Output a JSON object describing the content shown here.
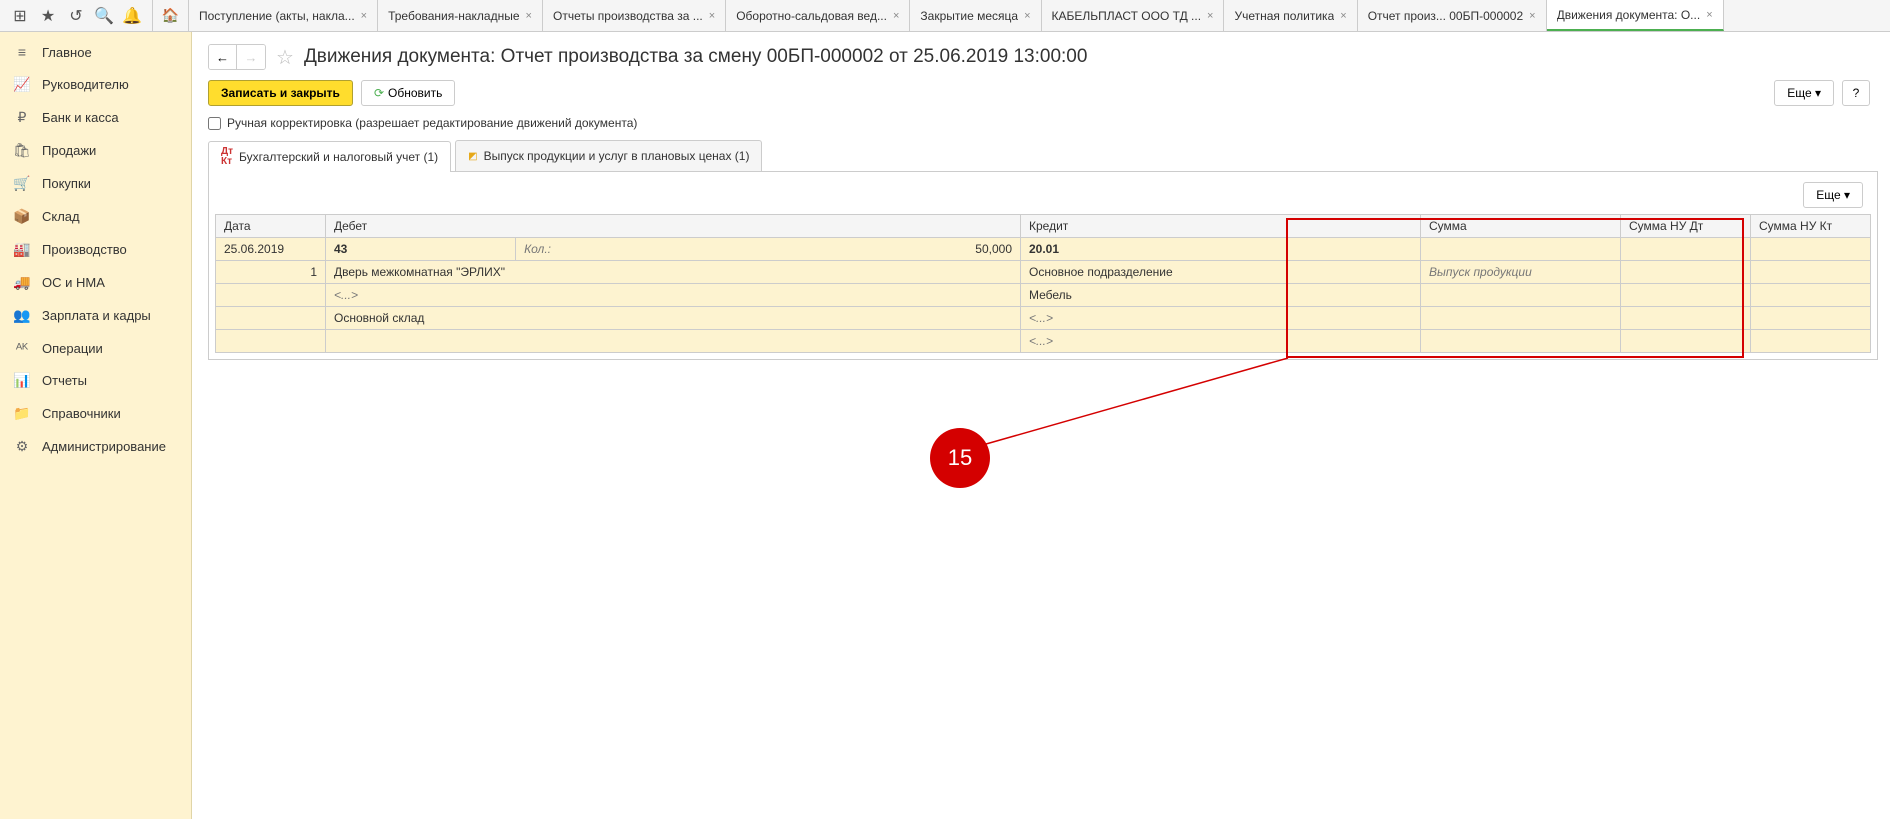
{
  "toolbar_tabs": [
    {
      "label": "Поступление (акты, накла...",
      "close": true
    },
    {
      "label": "Требования-накладные",
      "close": true
    },
    {
      "label": "Отчеты производства за ...",
      "close": true
    },
    {
      "label": "Оборотно-сальдовая вед...",
      "close": true
    },
    {
      "label": "Закрытие месяца",
      "close": true
    },
    {
      "label": "КАБЕЛЬПЛАСТ ООО ТД ...",
      "close": true
    },
    {
      "label": "Учетная политика",
      "close": true
    },
    {
      "label": "Отчет произ... 00БП-000002",
      "close": true
    },
    {
      "label": "Движения документа: О...",
      "close": true,
      "active": true
    }
  ],
  "sidebar_items": [
    {
      "icon": "≡",
      "label": "Главное"
    },
    {
      "icon": "📈",
      "label": "Руководителю"
    },
    {
      "icon": "₽",
      "label": "Банк и касса"
    },
    {
      "icon": "🛍",
      "label": "Продажи"
    },
    {
      "icon": "🛒",
      "label": "Покупки"
    },
    {
      "icon": "📦",
      "label": "Склад"
    },
    {
      "icon": "🏭",
      "label": "Производство"
    },
    {
      "icon": "🚚",
      "label": "ОС и НМА"
    },
    {
      "icon": "👥",
      "label": "Зарплата и кадры"
    },
    {
      "icon": "ᴬᴷ",
      "label": "Операции"
    },
    {
      "icon": "📊",
      "label": "Отчеты"
    },
    {
      "icon": "📁",
      "label": "Справочники"
    },
    {
      "icon": "⚙",
      "label": "Администрирование"
    }
  ],
  "page_title": "Движения документа: Отчет производства за смену 00БП-000002 от 25.06.2019 13:00:00",
  "btn_save_close": "Записать и закрыть",
  "btn_refresh": "Обновить",
  "btn_more": "Еще",
  "btn_help": "?",
  "checkbox_label": "Ручная корректировка (разрешает редактирование движений документа)",
  "subtabs": [
    {
      "label": "Бухгалтерский и налоговый учет (1)",
      "icon": "dtkt",
      "active": true
    },
    {
      "label": "Выпуск продукции и услуг в плановых ценах (1)",
      "icon": "box"
    }
  ],
  "table": {
    "headers": {
      "date": "Дата",
      "debit": "Дебет",
      "credit": "Кредит",
      "sum": "Сумма",
      "nu_dt": "Сумма НУ Дт",
      "nu_kt": "Сумма НУ Кт"
    },
    "rows": {
      "date": "25.06.2019",
      "num": "1",
      "debit_acc": "43",
      "kol_label": "Кол.:",
      "kol_val": "50,000",
      "debit_item": "Дверь межкомнатная \"ЭРЛИХ\"",
      "debit_empty": "<...>",
      "debit_wh": "Основной склад",
      "credit_acc": "20.01",
      "credit_dep": "Основное подразделение",
      "credit_group": "Мебель",
      "credit_empty1": "<...>",
      "credit_empty2": "<...>",
      "sum_note": "Выпуск продукции"
    }
  },
  "callout_number": "15"
}
